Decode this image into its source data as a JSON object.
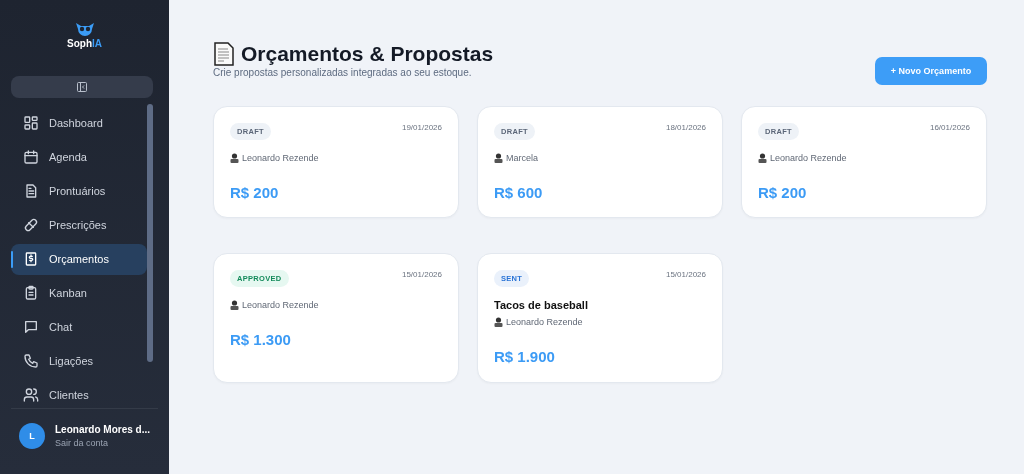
{
  "logo": {
    "text": "Soph",
    "accent": "IA"
  },
  "nav": [
    {
      "label": "Dashboard",
      "kind": "grid",
      "selected": false
    },
    {
      "label": "Agenda",
      "kind": "calendar",
      "selected": false
    },
    {
      "label": "Prontuários",
      "kind": "file",
      "selected": false
    },
    {
      "label": "Prescrições",
      "kind": "pill",
      "selected": false
    },
    {
      "label": "Orçamentos",
      "kind": "money",
      "selected": true
    },
    {
      "label": "Kanban",
      "kind": "clipboard",
      "selected": false
    },
    {
      "label": "Chat",
      "kind": "chat",
      "selected": false
    },
    {
      "label": "Ligações",
      "kind": "phone",
      "selected": false
    },
    {
      "label": "Clientes",
      "kind": "users",
      "selected": false
    }
  ],
  "user": {
    "initial": "L",
    "name": "Leonardo Mores d...",
    "action": "Sair da conta"
  },
  "header": {
    "title": "Orçamentos & Propostas",
    "subtitle": "Crie propostas personalizadas integradas ao seu estoque.",
    "button": "+ Novo Orçamento"
  },
  "cards": [
    {
      "status": "DRAFT",
      "kind": "draft",
      "date": "19/01/2026",
      "client": "Leonardo Rezende",
      "amount": "R$ 200"
    },
    {
      "status": "DRAFT",
      "kind": "draft",
      "date": "18/01/2026",
      "client": "Marcela",
      "amount": "R$ 600"
    },
    {
      "status": "DRAFT",
      "kind": "draft",
      "date": "16/01/2026",
      "client": "Leonardo Rezende",
      "amount": "R$ 200"
    },
    {
      "status": "APPROVED",
      "kind": "approved",
      "date": "15/01/2026",
      "client": "Leonardo Rezende",
      "amount": "R$ 1.300"
    },
    {
      "status": "SENT",
      "kind": "sent",
      "date": "15/01/2026",
      "title": "Tacos de baseball",
      "client": "Leonardo Rezende",
      "amount": "R$ 1.900"
    }
  ]
}
